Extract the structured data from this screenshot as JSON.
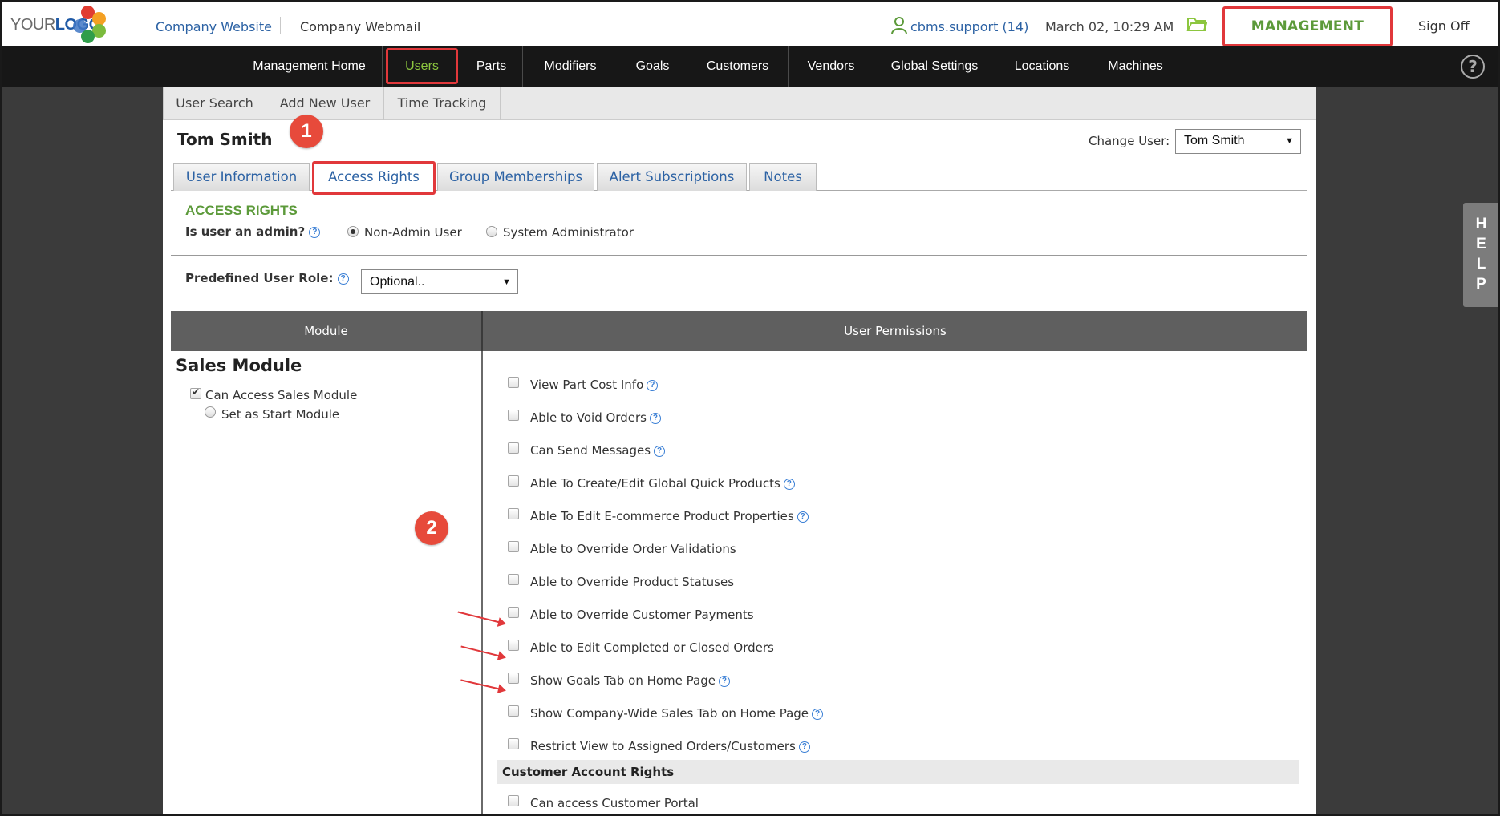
{
  "header": {
    "logo": {
      "part1": "YOUR",
      "part2": "LOGO"
    },
    "company_website": "Company Website",
    "company_webmail": "Company Webmail",
    "user": "cbms.support (14)",
    "datetime": "March 02, 10:29 AM",
    "management": "MANAGEMENT",
    "sign_off": "Sign Off"
  },
  "nav": {
    "items": [
      "Management Home",
      "Users",
      "Parts",
      "Modifiers",
      "Goals",
      "Customers",
      "Vendors",
      "Global Settings",
      "Locations",
      "Machines"
    ],
    "active": "Users",
    "help": "?"
  },
  "subtabs": [
    "User Search",
    "Add New User",
    "Time Tracking"
  ],
  "user": {
    "name": "Tom Smith",
    "change_user_label": "Change User:",
    "change_user_value": "Tom Smith"
  },
  "page_tabs": [
    "User Information",
    "Access Rights",
    "Group Memberships",
    "Alert Subscriptions",
    "Notes"
  ],
  "access_rights": {
    "title": "ACCESS RIGHTS",
    "admin_question": "Is user an admin?",
    "options": [
      "Non-Admin User",
      "System Administrator"
    ],
    "selected": "Non-Admin User",
    "role_label": "Predefined User Role:",
    "role_value": "Optional.."
  },
  "grid": {
    "module_header": "Module",
    "permissions_header": "User Permissions"
  },
  "sales_module": {
    "title": "Sales Module",
    "can_access": "Can Access Sales Module",
    "can_access_checked": true,
    "start_module": "Set as Start Module"
  },
  "permissions": [
    {
      "label": "View Part Cost Info",
      "help": true
    },
    {
      "label": "Able to Void Orders",
      "help": true
    },
    {
      "label": "Can Send Messages",
      "help": true
    },
    {
      "label": "Able To Create/Edit Global Quick Products",
      "help": true
    },
    {
      "label": "Able To Edit E-commerce Product Properties",
      "help": true
    },
    {
      "label": "Able to Override Order Validations",
      "help": false
    },
    {
      "label": "Able to Override Product Statuses",
      "help": false
    },
    {
      "label": "Able to Override Customer Payments",
      "help": false
    },
    {
      "label": "Able to Edit Completed or Closed Orders",
      "help": false
    },
    {
      "label": "Show Goals Tab on Home Page",
      "help": true
    },
    {
      "label": "Show Company-Wide Sales Tab on Home Page",
      "help": true
    },
    {
      "label": "Restrict View to Assigned Orders/Customers",
      "help": true
    }
  ],
  "customer_account": {
    "title": "Customer Account Rights",
    "portal": "Can access Customer Portal"
  },
  "annotations": {
    "badge1": "1",
    "badge2": "2"
  },
  "help_side": "HELP",
  "colors": {
    "accent_green": "#5c9a3a",
    "link_blue": "#2c62a4",
    "highlight_red": "#e1383b",
    "nav_bg": "#171717"
  }
}
